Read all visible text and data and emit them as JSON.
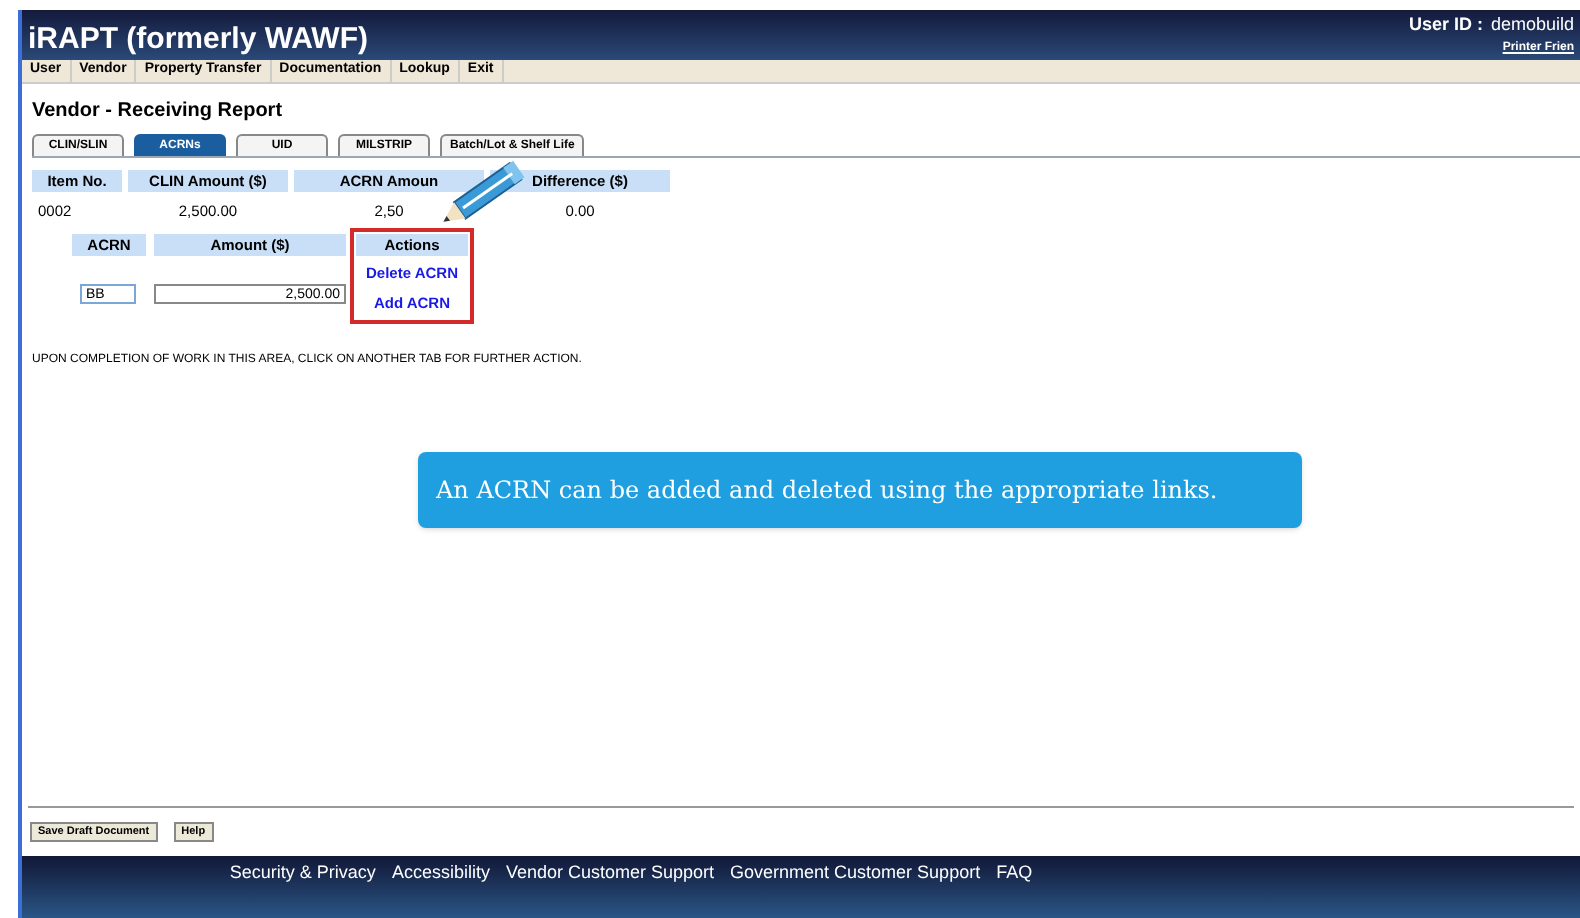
{
  "header": {
    "title": "iRAPT (formerly WAWF)",
    "user_label": "User ID :",
    "user_id": "demobuild",
    "printer_link": "Printer Frien"
  },
  "menu": [
    "User",
    "Vendor",
    "Property Transfer",
    "Documentation",
    "Lookup",
    "Exit"
  ],
  "page_title": "Vendor - Receiving Report",
  "tabs": [
    {
      "label": "CLIN/SLIN",
      "selected": false
    },
    {
      "label": "ACRNs",
      "selected": true
    },
    {
      "label": "UID",
      "selected": false
    },
    {
      "label": "MILSTRIP",
      "selected": false
    },
    {
      "label": "Batch/Lot & Shelf Life",
      "selected": false
    }
  ],
  "clin_table": {
    "columns": [
      "Item No.",
      "CLIN Amount ($)",
      "ACRN Amoun",
      "Difference ($)"
    ],
    "row": [
      "0002",
      "2,500.00",
      "2,50",
      "0.00"
    ]
  },
  "acrn_table": {
    "columns": [
      "ACRN",
      "Amount ($)",
      "Actions"
    ],
    "acrn": "BB",
    "amount": "2,500.00",
    "links": [
      "Delete ACRN",
      "Add ACRN"
    ]
  },
  "notice": "UPON COMPLETION OF WORK IN THIS AREA, CLICK ON ANOTHER TAB FOR FURTHER ACTION.",
  "callout": "An ACRN can be added and deleted using the appropriate links.",
  "buttons": [
    "Save Draft Document",
    "Help"
  ],
  "footer_links": [
    "Security & Privacy",
    "Accessibility",
    "Vendor Customer Support",
    "Government Customer Support",
    "FAQ"
  ]
}
